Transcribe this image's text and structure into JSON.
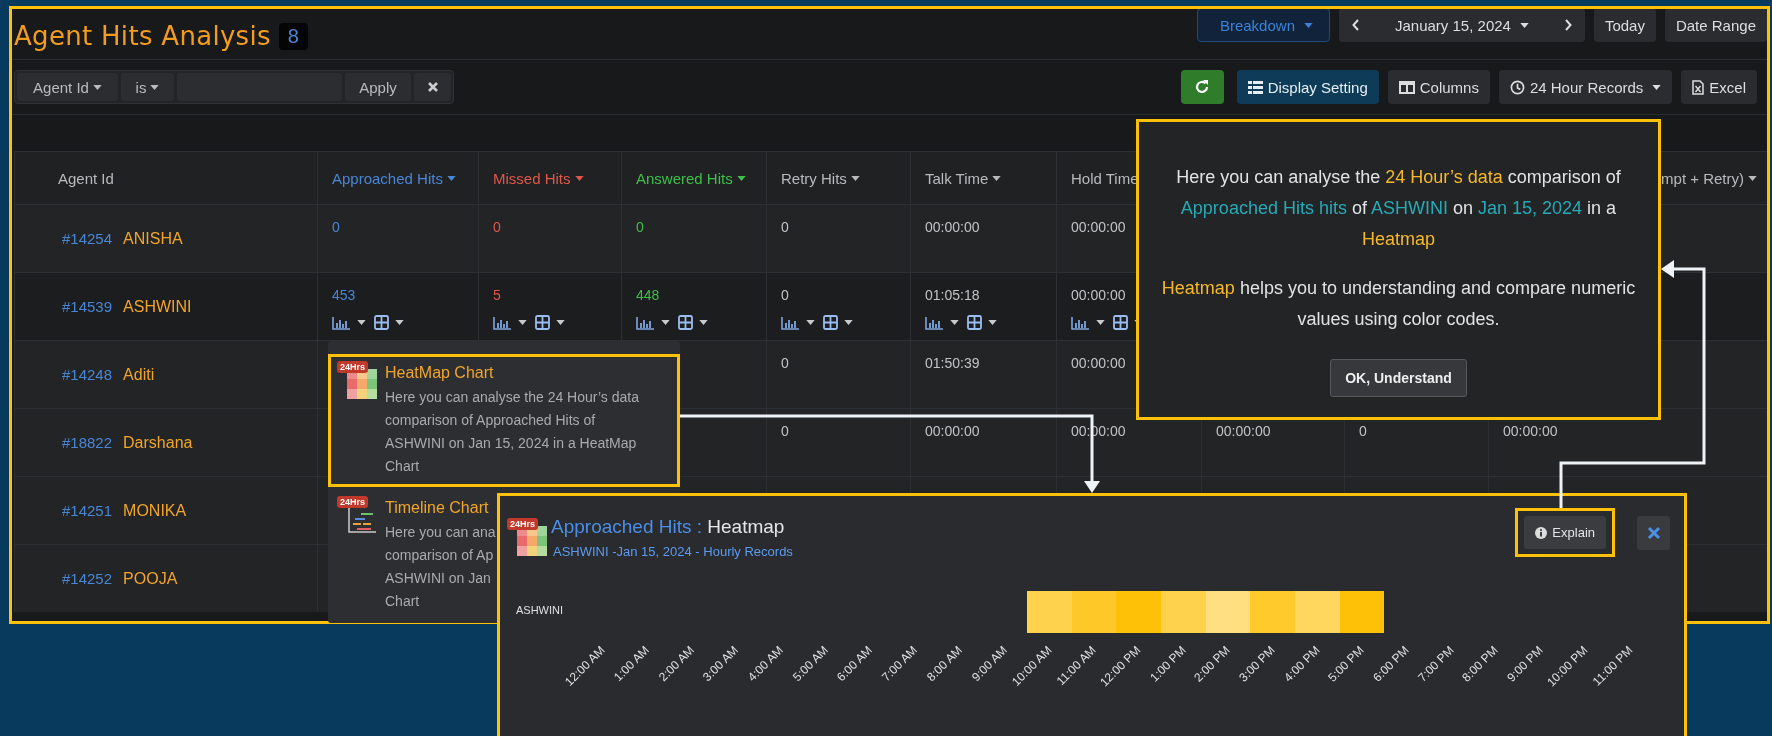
{
  "header": {
    "title": "Agent Hits Analysis",
    "count": "8",
    "breakdown": "Breakdown",
    "date": "January 15, 2024",
    "today": "Today",
    "date_range": "Date Range"
  },
  "filter": {
    "field": "Agent Id",
    "operator": "is",
    "apply": "Apply"
  },
  "toolbar": {
    "display_setting": "Display Setting",
    "columns": "Columns",
    "records": "24 Hour Records",
    "excel": "Excel"
  },
  "table": {
    "agent_column": {
      "label": "Agent Id"
    },
    "columns": [
      {
        "label": "Approached Hits",
        "color": "#4a86d6",
        "caret": true
      },
      {
        "label": "Missed Hits",
        "color": "#e0584c",
        "caret": true
      },
      {
        "label": "Answered Hits",
        "color": "#3fbf4a",
        "caret": true
      },
      {
        "label": "Retry Hits",
        "caret": true
      },
      {
        "label": "Talk Time",
        "caret": true
      },
      {
        "label": "Hold Time",
        "caret": false
      },
      {},
      {},
      {
        "label": "mpt + Retry)",
        "caret": true
      }
    ],
    "rows": [
      {
        "agent_id": "#14254",
        "name": "ANISHA",
        "chart_tools": false,
        "cells": [
          "0",
          "0",
          "0",
          "0",
          "00:00:00",
          "00:00:00",
          null,
          null,
          null
        ]
      },
      {
        "agent_id": "#14539",
        "name": "ASHWINI",
        "chart_tools": true,
        "cells": [
          "453",
          "5",
          "448",
          "0",
          "01:05:18",
          "00:00:00",
          null,
          null,
          null
        ]
      },
      {
        "agent_id": "#14248",
        "name": "Aditi",
        "chart_tools": false,
        "cells": [
          null,
          null,
          null,
          "0",
          "01:50:39",
          "00:00:00",
          null,
          null,
          null
        ]
      },
      {
        "agent_id": "#18822",
        "name": "Darshana",
        "chart_tools": false,
        "cells": [
          null,
          null,
          null,
          "0",
          "00:00:00",
          "00:00:00",
          "00:00:00",
          "0",
          "00:00:00"
        ]
      },
      {
        "agent_id": "#14251",
        "name": "MONIKA",
        "chart_tools": false,
        "cells": [
          null,
          null,
          null,
          null,
          null,
          null,
          null,
          null,
          null
        ]
      },
      {
        "agent_id": "#14252",
        "name": "POOJA",
        "chart_tools": false,
        "cells": [
          null,
          null,
          null,
          null,
          null,
          null,
          null,
          null,
          null
        ]
      }
    ]
  },
  "chart_menu": {
    "items": [
      {
        "kind": "heatmap",
        "badge": "24Hrs",
        "title": "HeatMap Chart",
        "highlighted": true,
        "lines": [
          "Here you can analyse the 24 Hour’s data",
          "comparison of Approached Hits of",
          "ASHWINI on Jan 15, 2024 in a HeatMap",
          "Chart"
        ]
      },
      {
        "kind": "timeline",
        "badge": "24Hrs",
        "title": "Timeline Chart",
        "highlighted": false,
        "lines": [
          "Here you can ana",
          "comparison of Ap",
          "ASHWINI on Jan",
          "Chart"
        ]
      }
    ]
  },
  "explain_popover": {
    "paragraphs": [
      [
        {
          "text": "Here you can analyse the ",
          "color": "#e2e3e4"
        },
        {
          "text": "24 Hour’s data",
          "color": "#f7b928"
        },
        {
          "text": " comparison of ",
          "color": "#e2e3e4"
        },
        {
          "text": "Approached Hits hits",
          "color": "#26aab8"
        },
        {
          "text": " of ",
          "color": "#e2e3e4"
        },
        {
          "text": "ASHWINI",
          "color": "#26aab8"
        },
        {
          "text": " on ",
          "color": "#e2e3e4"
        },
        {
          "text": "Jan 15, 2024",
          "color": "#26aab8"
        },
        {
          "text": " in a ",
          "color": "#e2e3e4"
        },
        {
          "text": "Heatmap",
          "color": "#f7b928"
        }
      ],
      [
        {
          "text": "Heatmap",
          "color": "#f7b928"
        },
        {
          "text": " helps you to understanding and compare numeric values using color codes.",
          "color": "#e2e3e4"
        }
      ]
    ],
    "button": "OK, Understand"
  },
  "heatmap_panel": {
    "badge": "24Hrs",
    "title": "Approached Hits :",
    "chart_name": "Heatmap",
    "subtitle": "ASHWINI -Jan 15, 2024 - Hourly Records",
    "explain": "Explain",
    "explain_highlighted": true,
    "row_label": "ASHWINI",
    "hours": [
      {
        "label": "12:00 AM"
      },
      {
        "label": "1:00 AM"
      },
      {
        "label": "2:00 AM"
      },
      {
        "label": "3:00 AM"
      },
      {
        "label": "4:00 AM"
      },
      {
        "label": "5:00 AM"
      },
      {
        "label": "6:00 AM"
      },
      {
        "label": "7:00 AM"
      },
      {
        "label": "8:00 AM"
      },
      {
        "label": "9:00 AM"
      },
      {
        "label": "10:00 AM",
        "color": "#ffd24d"
      },
      {
        "label": "11:00 AM",
        "color": "#ffc829"
      },
      {
        "label": "12:00 PM",
        "color": "#ffc107"
      },
      {
        "label": "1:00 PM",
        "color": "#ffd24d"
      },
      {
        "label": "2:00 PM",
        "color": "#ffdf80"
      },
      {
        "label": "3:00 PM",
        "color": "#ffca2c"
      },
      {
        "label": "4:00 PM",
        "color": "#ffd75e"
      },
      {
        "label": "5:00 PM",
        "color": "#ffc107"
      },
      {
        "label": "6:00 PM"
      },
      {
        "label": "7:00 PM"
      },
      {
        "label": "8:00 PM"
      },
      {
        "label": "9:00 PM"
      },
      {
        "label": "10:00 PM"
      },
      {
        "label": "11:00 PM"
      }
    ]
  }
}
